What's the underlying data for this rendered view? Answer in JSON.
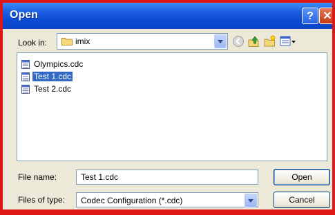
{
  "window": {
    "title": "Open",
    "help_icon": "help-icon",
    "close_icon": "close-icon"
  },
  "lookin": {
    "label": "Look in:",
    "value": "imix",
    "icon": "folder-icon"
  },
  "toolbar": {
    "icons": [
      "back-icon",
      "up-folder-icon",
      "new-folder-icon",
      "views-menu-icon"
    ]
  },
  "files": [
    {
      "name": "Olympics.cdc",
      "selected": false
    },
    {
      "name": "Test 1.cdc",
      "selected": true
    },
    {
      "name": "Test 2.cdc",
      "selected": false
    }
  ],
  "filename": {
    "label": "File name:",
    "value": "Test 1.cdc"
  },
  "filetype": {
    "label": "Files of type:",
    "value": "Codec Configuration (*.cdc)"
  },
  "buttons": {
    "open": "Open",
    "cancel": "Cancel"
  },
  "colors": {
    "titlebar": "#0a4ad3",
    "selection": "#316ac5",
    "frame": "#e01515",
    "dialog": "#ece9d8"
  }
}
